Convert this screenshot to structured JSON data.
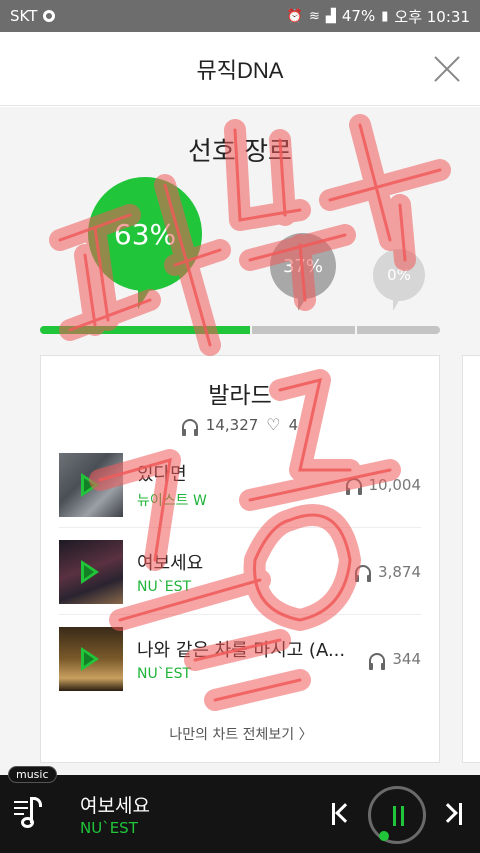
{
  "status_bar": {
    "carrier": "SKT",
    "battery": "47%",
    "time": "오후 10:31"
  },
  "header": {
    "title": "뮤직DNA"
  },
  "genre_section": {
    "title": "선호 장르",
    "bubbles": [
      {
        "label": "63%",
        "value": 0.63,
        "color": "#20c53a"
      },
      {
        "label": "37%",
        "value": 0.37,
        "color": "#a8a8a8"
      },
      {
        "label": "0%",
        "value": 0.0,
        "color": "#d6d6d6"
      }
    ]
  },
  "genre_card": {
    "title": "발라드",
    "play_count": "14,327",
    "like_count": "4",
    "songs": [
      {
        "title": "있다면",
        "artist": "뉴이스트 W",
        "plays": "10,004"
      },
      {
        "title": "여보세요",
        "artist": "NU`EST",
        "plays": "3,874"
      },
      {
        "title": "나와 같은 차를 마시고 (A...",
        "artist": "NU`EST",
        "plays": "344"
      }
    ],
    "chart_link": "나만의 차트 전체보기 〉"
  },
  "player": {
    "tag": "music",
    "title": "여보세요",
    "artist": "NU`EST"
  },
  "colors": {
    "accent": "#20c53a",
    "player_bg": "#141414",
    "watermark": "#f05a5a"
  },
  "watermark_text": "피처폰 전용"
}
